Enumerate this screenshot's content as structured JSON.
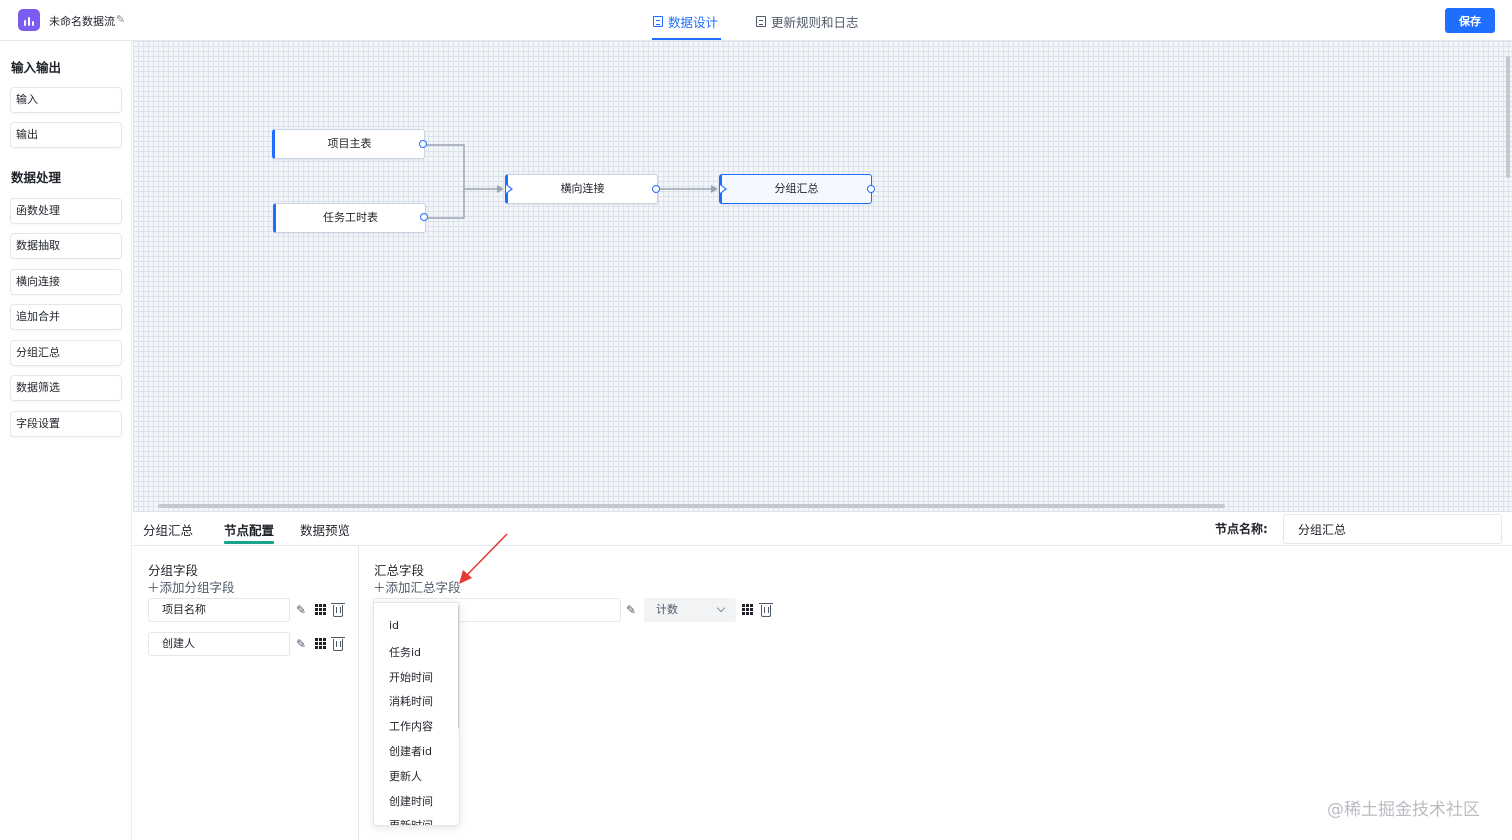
{
  "header": {
    "app_title": "未命名数据流",
    "tabs": [
      {
        "label": "数据设计",
        "active": true
      },
      {
        "label": "更新规则和日志",
        "active": false
      }
    ],
    "save_label": "保存",
    "accent_color": "#1e6fff"
  },
  "sidebar": {
    "groups": [
      {
        "title": "输入输出",
        "items": [
          "输入",
          "输出"
        ]
      },
      {
        "title": "数据处理",
        "items": [
          "函数处理",
          "数据抽取",
          "横向连接",
          "追加合并",
          "分组汇总",
          "数据筛选",
          "字段设置"
        ]
      }
    ]
  },
  "canvas": {
    "nodes": [
      {
        "label": "项目主表"
      },
      {
        "label": "任务工时表"
      },
      {
        "label": "横向连接"
      },
      {
        "label": "分组汇总",
        "selected": true
      }
    ]
  },
  "panel": {
    "tabs": [
      "分组汇总",
      "节点配置",
      "数据预览"
    ],
    "active_tab": "节点配置",
    "active_tab_color": "#19a38a",
    "node_name_label": "节点名称:",
    "node_name_value": "分组汇总",
    "group_section": {
      "title": "分组字段",
      "add_label": "＋添加分组字段",
      "fields": [
        "项目名称",
        "创建人"
      ]
    },
    "summary_section": {
      "title": "汇总字段",
      "add_label": "＋添加汇总字段",
      "aggregation": "计数",
      "dropdown_options": [
        "id",
        "任务id",
        "开始时间",
        "消耗时间",
        "工作内容",
        "创建者id",
        "更新人",
        "创建时间",
        "更新时间"
      ]
    }
  },
  "watermark": "@稀土掘金技术社区"
}
